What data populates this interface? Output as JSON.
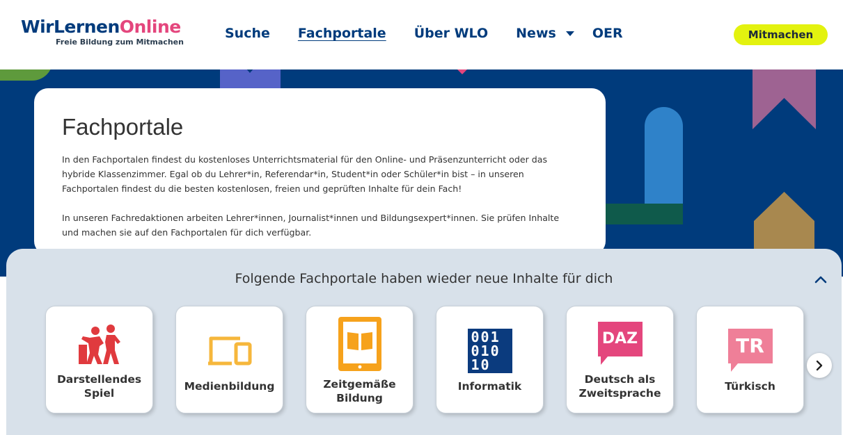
{
  "header": {
    "logo": {
      "part1": "WirLernen",
      "part2": "Online",
      "tagline": "Freie Bildung zum Mitmachen"
    },
    "nav": [
      {
        "label": "Suche"
      },
      {
        "label": "Fachportale"
      },
      {
        "label": "Über WLO"
      },
      {
        "label": "News"
      },
      {
        "label": "OER"
      }
    ],
    "cta_label": "Mitmachen"
  },
  "intro": {
    "title": "Fachportale",
    "paragraph1": "In den Fachportalen findest du kostenloses Unterrichtsmaterial für den Online- und Präsenzunterricht oder das hybride Klassenzimmer. Egal ob du Lehrer*in, Referendar*in, Student*in oder Schüler*in bist – in unseren Fachportalen findest du die besten kostenlosen, freien und geprüften Inhalte für dein Fach!",
    "paragraph2": "In unseren Fachredaktionen arbeiten Lehrer*innen, Journalist*innen und Bildungsexpert*innen. Sie prüfen Inhalte und machen sie auf den Fachportalen für dich verfügbar."
  },
  "new_content": {
    "title": "Folgende Fachportale haben wieder neue Inhalte für dich",
    "portals": [
      {
        "label": "Darstellendes Spiel",
        "icon": "theater-figures-icon"
      },
      {
        "label": "Medienbildung",
        "icon": "devices-icon"
      },
      {
        "label": "Zeitgemäße Bildung",
        "icon": "tablet-book-icon"
      },
      {
        "label": "Informatik",
        "icon": "binary-code-icon",
        "binary": [
          "001",
          "010",
          "10"
        ]
      },
      {
        "label": "Deutsch als Zweitsprache",
        "icon": "daz-speech-bubble-icon",
        "badge": "DAZ"
      },
      {
        "label": "Türkisch",
        "icon": "tr-speech-bubble-icon",
        "badge": "TR"
      }
    ]
  },
  "colors": {
    "brand_blue": "#003b7c",
    "brand_pink": "#e4467d",
    "cta_yellow": "#e3f20f",
    "panel_bg": "#d8e1ea"
  }
}
